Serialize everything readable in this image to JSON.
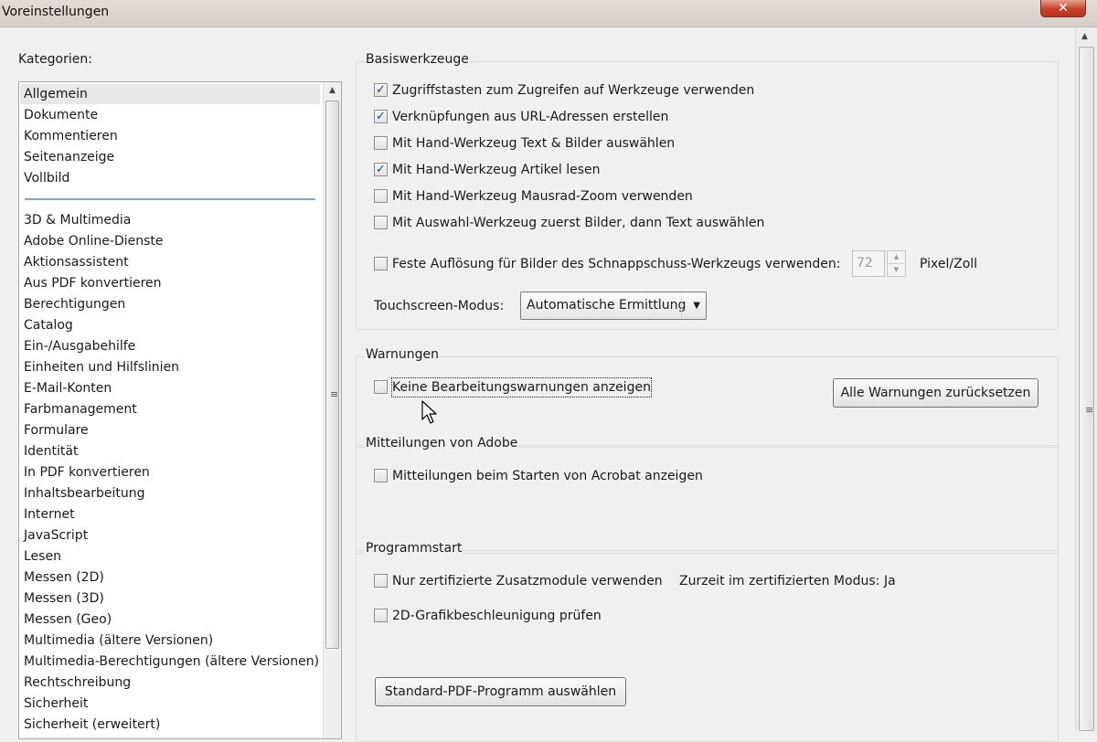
{
  "window": {
    "title": "Voreinstellungen",
    "close_icon": "✕"
  },
  "categories": {
    "label": "Kategorien:",
    "top_items": [
      "Allgemein",
      "Dokumente",
      "Kommentieren",
      "Seitenanzeige",
      "Vollbild"
    ],
    "items": [
      "3D & Multimedia",
      "Adobe Online-Dienste",
      "Aktionsassistent",
      "Aus PDF konvertieren",
      "Berechtigungen",
      "Catalog",
      "Ein-/Ausgabehilfe",
      "Einheiten und Hilfslinien",
      "E-Mail-Konten",
      "Farbmanagement",
      "Formulare",
      "Identität",
      "In PDF konvertieren",
      "Inhaltsbearbeitung",
      "Internet",
      "JavaScript",
      "Lesen",
      "Messen (2D)",
      "Messen (3D)",
      "Messen (Geo)",
      "Multimedia (ältere Versionen)",
      "Multimedia-Berechtigungen (ältere Versionen)",
      "Rechtschreibung",
      "Sicherheit",
      "Sicherheit (erweitert)"
    ],
    "selected": "Allgemein"
  },
  "basis": {
    "title": "Basiswerkzeuge",
    "checkboxes": [
      {
        "label": "Zugriffstasten zum Zugreifen auf Werkzeuge verwenden",
        "checked": true
      },
      {
        "label": "Verknüpfungen aus URL-Adressen erstellen",
        "checked": true
      },
      {
        "label": "Mit Hand-Werkzeug Text & Bilder auswählen",
        "checked": false
      },
      {
        "label": "Mit Hand-Werkzeug Artikel lesen",
        "checked": true
      },
      {
        "label": "Mit Hand-Werkzeug Mausrad-Zoom verwenden",
        "checked": false
      },
      {
        "label": "Mit Auswahl-Werkzeug zuerst Bilder, dann Text auswählen",
        "checked": false
      }
    ],
    "resolution": {
      "label": "Feste Auflösung für Bilder des Schnappschuss-Werkzeugs verwenden:",
      "checked": false,
      "value": "72",
      "unit": "Pixel/Zoll"
    },
    "touch": {
      "label": "Touchscreen-Modus:",
      "value": "Automatische Ermittlung"
    }
  },
  "warnings": {
    "title": "Warnungen",
    "checkbox": {
      "label": "Keine Bearbeitungswarnungen anzeigen",
      "checked": false
    },
    "reset_button": "Alle Warnungen zurücksetzen"
  },
  "messages": {
    "title": "Mitteilungen von Adobe",
    "checkbox": {
      "label": "Mitteilungen beim Starten von Acrobat anzeigen",
      "checked": false
    }
  },
  "startup": {
    "title": "Programmstart",
    "certified": {
      "label": "Nur zertifizierte Zusatzmodule verwenden",
      "checked": false
    },
    "certified_mode_label": "Zurzeit im zertifizierten Modus:",
    "certified_mode_value": "Ja",
    "gpu": {
      "label": "2D-Grafikbeschleunigung prüfen",
      "checked": false
    },
    "default_pdf_button": "Standard-PDF-Programm auswählen"
  },
  "icons": {
    "checkmark": "✓",
    "arrow_up": "▲",
    "arrow_down": "▼",
    "grip": "≡",
    "caret": "▼"
  }
}
